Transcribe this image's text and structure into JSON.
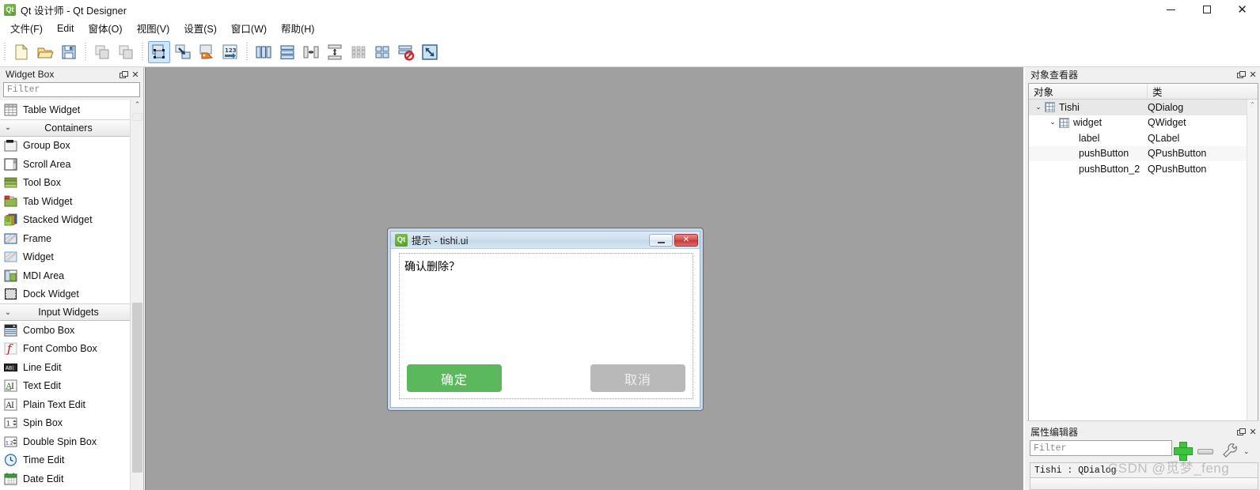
{
  "window": {
    "title": "Qt 设计师 - Qt Designer",
    "logo_text": "Qt",
    "minimize_label": "minimize",
    "maximize_label": "maximize",
    "close_label": "✕"
  },
  "menubar": {
    "items": [
      {
        "label": "文件(F)",
        "mnemonic": "F"
      },
      {
        "label": "Edit",
        "mnemonic": "E"
      },
      {
        "label": "窗体(O)",
        "mnemonic": "O"
      },
      {
        "label": "视图(V)",
        "mnemonic": "V"
      },
      {
        "label": "设置(S)",
        "mnemonic": "S"
      },
      {
        "label": "窗口(W)",
        "mnemonic": "W"
      },
      {
        "label": "帮助(H)",
        "mnemonic": "H"
      }
    ]
  },
  "toolbar": {
    "groups": [
      {
        "items": [
          {
            "name": "new-form-icon",
            "title": "New"
          },
          {
            "name": "open-folder-icon",
            "title": "Open"
          },
          {
            "name": "save-icon",
            "title": "Save"
          }
        ]
      },
      {
        "items": [
          {
            "name": "undo-icon",
            "title": "Undo"
          },
          {
            "name": "redo-icon",
            "title": "Redo"
          }
        ]
      },
      {
        "items": [
          {
            "name": "edit-widgets-icon",
            "title": "Edit Widgets",
            "active": true
          },
          {
            "name": "edit-signals-slots-icon",
            "title": "Edit Signals/Slots",
            "active": false
          },
          {
            "name": "edit-buddies-icon",
            "title": "Edit Buddies",
            "active": false
          },
          {
            "name": "edit-tab-order-icon",
            "title": "Edit Tab Order",
            "active": false
          }
        ]
      },
      {
        "items": [
          {
            "name": "layout-horizontally-icon",
            "title": "Lay Out Horizontally"
          },
          {
            "name": "layout-vertically-icon",
            "title": "Lay Out Vertically"
          },
          {
            "name": "layout-splitter-horizontal-icon",
            "title": "Lay Out in a Splitter Horizontally"
          },
          {
            "name": "layout-splitter-vertical-icon",
            "title": "Lay Out in a Splitter Vertically"
          },
          {
            "name": "layout-grid-icon",
            "title": "Lay Out in a Grid"
          },
          {
            "name": "layout-form-icon",
            "title": "Lay Out in a Form Layout"
          },
          {
            "name": "break-layout-icon",
            "title": "Break Layout"
          },
          {
            "name": "adjust-size-icon",
            "title": "Adjust Size"
          }
        ]
      }
    ]
  },
  "widget_box": {
    "title": "Widget Box",
    "filter_placeholder": "Filter",
    "filter_value": "",
    "rows": [
      {
        "type": "item",
        "label": "Table Widget",
        "icon": "table-widget-icon"
      },
      {
        "type": "category",
        "label": "Containers",
        "expanded": true
      },
      {
        "type": "item",
        "label": "Group Box",
        "icon": "group-box-icon"
      },
      {
        "type": "item",
        "label": "Scroll Area",
        "icon": "scroll-area-icon"
      },
      {
        "type": "item",
        "label": "Tool Box",
        "icon": "tool-box-icon"
      },
      {
        "type": "item",
        "label": "Tab Widget",
        "icon": "tab-widget-icon"
      },
      {
        "type": "item",
        "label": "Stacked Widget",
        "icon": "stacked-widget-icon"
      },
      {
        "type": "item",
        "label": "Frame",
        "icon": "frame-icon"
      },
      {
        "type": "item",
        "label": "Widget",
        "icon": "widget-icon"
      },
      {
        "type": "item",
        "label": "MDI Area",
        "icon": "mdi-area-icon"
      },
      {
        "type": "item",
        "label": "Dock Widget",
        "icon": "dock-widget-icon"
      },
      {
        "type": "category",
        "label": "Input Widgets",
        "expanded": true
      },
      {
        "type": "item",
        "label": "Combo Box",
        "icon": "combo-box-icon"
      },
      {
        "type": "item",
        "label": "Font Combo Box",
        "icon": "font-combo-box-icon"
      },
      {
        "type": "item",
        "label": "Line Edit",
        "icon": "line-edit-icon"
      },
      {
        "type": "item",
        "label": "Text Edit",
        "icon": "text-edit-icon"
      },
      {
        "type": "item",
        "label": "Plain Text Edit",
        "icon": "plain-text-edit-icon"
      },
      {
        "type": "item",
        "label": "Spin Box",
        "icon": "spin-box-icon"
      },
      {
        "type": "item",
        "label": "Double Spin Box",
        "icon": "double-spin-box-icon"
      },
      {
        "type": "item",
        "label": "Time Edit",
        "icon": "time-edit-icon"
      },
      {
        "type": "item",
        "label": "Date Edit",
        "icon": "date-edit-icon"
      }
    ]
  },
  "form": {
    "title": "提示 - tishi.ui",
    "logo_text": "Qt",
    "minimize_label": "minimize",
    "close_label": "✕",
    "label_text": "确认删除？",
    "ok_button": "确定",
    "cancel_button": "取消",
    "ok_color": "#5cb85c",
    "cancel_color": "#b9b9b9"
  },
  "object_inspector": {
    "title": "对象查看器",
    "columns": [
      "对象",
      "类"
    ],
    "rows": [
      {
        "name": "Tishi",
        "class": "QDialog",
        "depth": 0,
        "expanded": true,
        "has_icon": true,
        "selected": true
      },
      {
        "name": "widget",
        "class": "QWidget",
        "depth": 1,
        "expanded": true,
        "has_icon": true,
        "selected": false
      },
      {
        "name": "label",
        "class": "QLabel",
        "depth": 2,
        "expanded": null,
        "has_icon": false,
        "selected": false
      },
      {
        "name": "pushButton",
        "class": "QPushButton",
        "depth": 2,
        "expanded": null,
        "has_icon": false,
        "selected": false,
        "alt": true
      },
      {
        "name": "pushButton_2",
        "class": "QPushButton",
        "depth": 2,
        "expanded": null,
        "has_icon": false,
        "selected": false
      }
    ]
  },
  "property_editor": {
    "title": "属性编辑器",
    "filter_placeholder": "Filter",
    "filter_value": "",
    "object_line": "Tishi : QDialog",
    "add_label": "add",
    "remove_label": "remove",
    "config_label": "configure"
  },
  "watermark": {
    "text": "CSDN @觅梦_feng"
  }
}
